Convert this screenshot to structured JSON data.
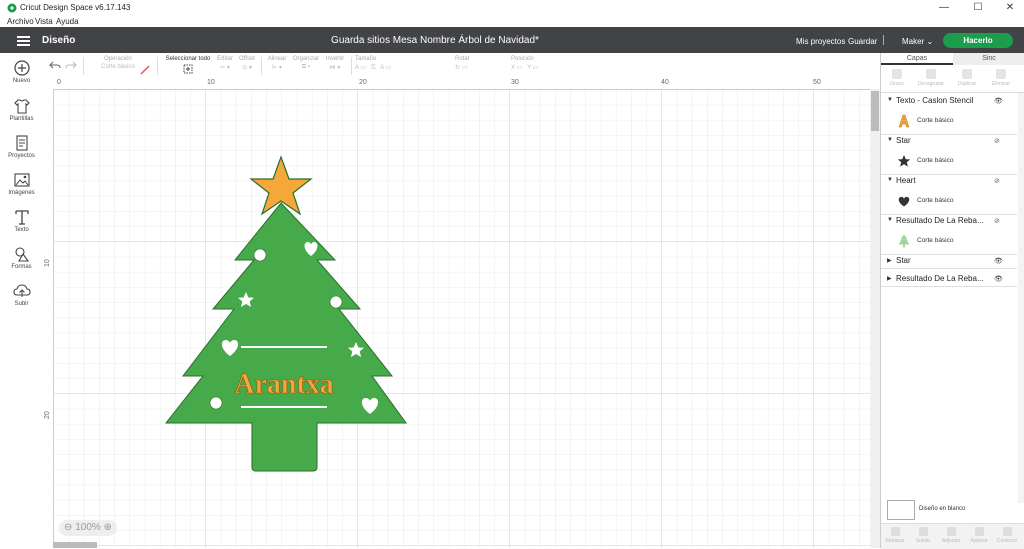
{
  "window": {
    "title": "Cricut Design Space  v6.17.143",
    "minimize": "—",
    "maximize": "☐",
    "close": "✕"
  },
  "menu": [
    "Archivo",
    "Vista",
    "Ayuda"
  ],
  "header": {
    "section": "Diseño",
    "project_title": "Guarda sitios Mesa Nombre Árbol de Navidad*",
    "my_projects": "Mis proyectos",
    "save": "Guardar",
    "machine": "Maker",
    "make_it": "Hacerlo"
  },
  "left_nav": [
    {
      "label": "Nuevo",
      "icon": "plus-circle-icon"
    },
    {
      "label": "Plantillas",
      "icon": "shirt-icon"
    },
    {
      "label": "Proyectos",
      "icon": "projects-icon"
    },
    {
      "label": "Imágenes",
      "icon": "image-icon"
    },
    {
      "label": "Texto",
      "icon": "text-icon"
    },
    {
      "label": "Formas",
      "icon": "shapes-icon"
    },
    {
      "label": "Subir",
      "icon": "upload-icon"
    }
  ],
  "toolbar": {
    "operation_label": "Operación",
    "operation_value": "Corte básico",
    "select_all": "Seleccionar todo",
    "edit": "Editar",
    "offset": "Offset",
    "align": "Alinear",
    "arrange": "Organizar",
    "flip": "Invertir",
    "size": "Tamaño",
    "size_w": "A",
    "size_h": "A",
    "rotate": "Rotar",
    "position": "Posición",
    "pos_x": "X",
    "pos_y": "Y"
  },
  "rulers": {
    "top": [
      "0",
      "10",
      "20",
      "30",
      "40",
      "50"
    ],
    "left": [
      "10",
      "20"
    ]
  },
  "canvas": {
    "zoom": "100%",
    "name_text": "Arantxa",
    "colors": {
      "tree": "#46a94a",
      "star": "#f5a83a",
      "text": "#f5a83a",
      "outline": "#2a6e2c"
    }
  },
  "right_panel": {
    "tabs": [
      "Capas",
      "Sinc"
    ],
    "layer_tools": [
      "Grupo",
      "Desagrupar",
      "Duplicar",
      "Eliminar"
    ],
    "layers": [
      {
        "name": "Texto - Caslon Stencil",
        "op": "Corte básico",
        "thumb": "text-a-icon",
        "visible": true,
        "expanded": true
      },
      {
        "name": "Star",
        "op": "Corte básico",
        "thumb": "star-icon",
        "visible": false,
        "expanded": true
      },
      {
        "name": "Heart",
        "op": "Corte básico",
        "thumb": "heart-icon",
        "visible": false,
        "expanded": true
      },
      {
        "name": "Resultado De La Reba...",
        "op": "Corte básico",
        "thumb": "tree-icon",
        "visible": false,
        "expanded": true
      },
      {
        "name": "Star",
        "op": "",
        "thumb": "",
        "visible": true,
        "expanded": false
      },
      {
        "name": "Resultado De La Reba...",
        "op": "",
        "thumb": "",
        "visible": true,
        "expanded": false
      }
    ],
    "blank_canvas": "Diseño en blanco",
    "bottom_tools": [
      "Rebanar",
      "Soldar",
      "Adjuntar",
      "Aplanar",
      "Contorno"
    ]
  }
}
